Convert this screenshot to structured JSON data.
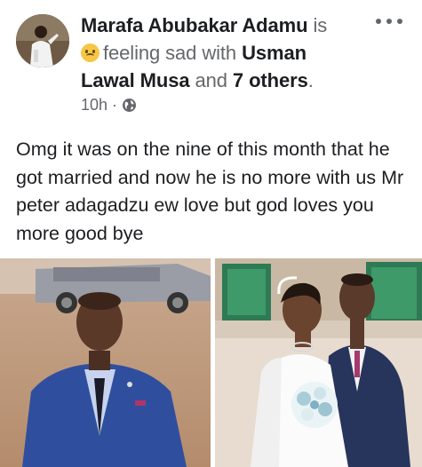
{
  "post": {
    "author": "Marafa Abubakar Adamu",
    "is_text": "is",
    "feeling_text": "feeling sad with",
    "tagged_name": "Usman Lawal Musa",
    "and_text": "and",
    "others_text": "7 others",
    "period": ".",
    "time": "10h",
    "separator": "·",
    "privacy_icon": "globe-icon",
    "feeling_icon": "sad-face-emoji",
    "menu_icon": "more-options-icon",
    "body": "Omg it was on the nine of this month that he got married and now he is no more with us Mr peter adagadzu ew love but god loves you more good bye"
  },
  "photos": [
    {
      "name": "photo-man-in-suit"
    },
    {
      "name": "photo-wedding-couple"
    }
  ],
  "colors": {
    "text_primary": "#1c1e21",
    "text_secondary": "#65676b",
    "emoji": "#f7c645"
  }
}
